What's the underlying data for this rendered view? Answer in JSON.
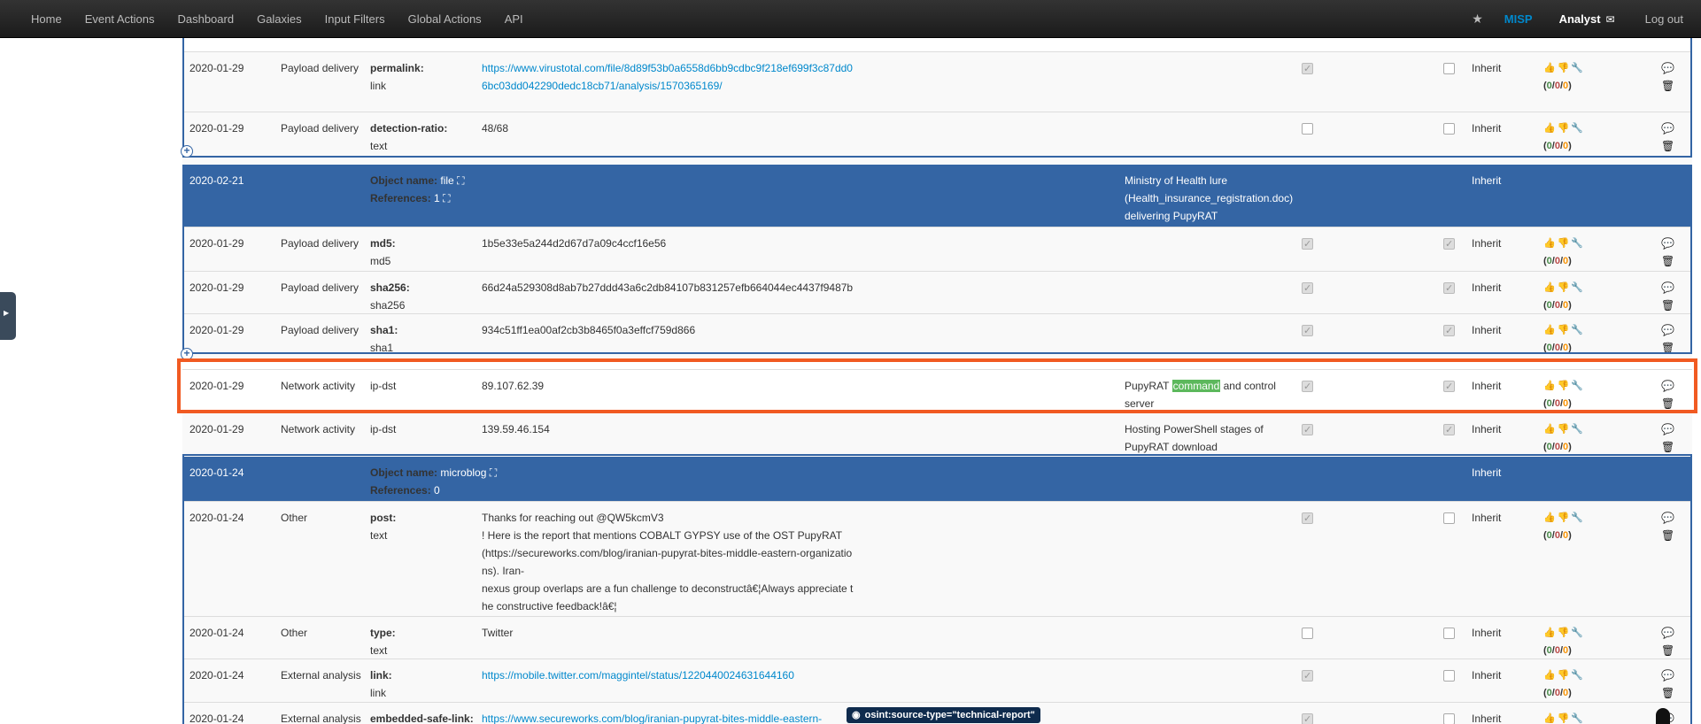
{
  "nav": {
    "items": [
      "Home",
      "Event Actions",
      "Dashboard",
      "Galaxies",
      "Input Filters",
      "Global Actions",
      "API"
    ],
    "star": "★",
    "misp": "MISP",
    "user": "Analyst",
    "logout": "Log out"
  },
  "rows": [
    {
      "date": "2020-01-29",
      "cat": "Payload delivery",
      "rel": "permalink:",
      "type": "link",
      "value": "https://www.virustotal.com/file/8d89f53b0a6558d6bb9cdbc9f218ef699f3c87dd06bc03dd042290dedc18cb71/analysis/1570365169/",
      "link": true,
      "comment": "",
      "ids": true,
      "corr": false,
      "dist": "Inherit"
    },
    {
      "date": "2020-01-29",
      "cat": "Payload delivery",
      "rel": "detection-ratio:",
      "type": "text",
      "value": "48/68",
      "comment": "",
      "ids": false,
      "corr": false,
      "dist": "Inherit"
    },
    {
      "obj": true,
      "date": "2020-02-21",
      "name_label": "Object name:",
      "name": "file",
      "refs_label": "References:",
      "refs": "1",
      "comment": "Ministry of Health lure (Health_insurance_registration.doc) delivering PupyRAT",
      "dist": "Inherit"
    },
    {
      "date": "2020-01-29",
      "cat": "Payload delivery",
      "rel": "md5:",
      "type": "md5",
      "value": "1b5e33e5a244d2d67d7a09c4ccf16e56",
      "comment": "",
      "ids": true,
      "corr": true,
      "dist": "Inherit"
    },
    {
      "date": "2020-01-29",
      "cat": "Payload delivery",
      "rel": "sha256:",
      "type": "sha256",
      "value": "66d24a529308d8ab7b27ddd43a6c2db84107b831257efb664044ec4437f9487b",
      "comment": "",
      "ids": true,
      "corr": true,
      "dist": "Inherit"
    },
    {
      "date": "2020-01-29",
      "cat": "Payload delivery",
      "rel": "sha1:",
      "type": "sha1",
      "value": "934c51ff1ea00af2cb3b8465f0a3effcf759d866",
      "comment": "",
      "ids": true,
      "corr": true,
      "dist": "Inherit"
    },
    {
      "date": "2020-01-29",
      "cat": "Network activity",
      "type_plain": "ip-dst",
      "value": "89.107.62.39",
      "comment_pre": "PupyRAT ",
      "comment_hl": "command",
      "comment_post": " and control server",
      "ids": true,
      "corr": true,
      "dist": "Inherit"
    },
    {
      "date": "2020-01-29",
      "cat": "Network activity",
      "type_plain": "ip-dst",
      "value": "139.59.46.154",
      "comment": "Hosting PowerShell stages of PupyRAT download",
      "ids": true,
      "corr": true,
      "dist": "Inherit"
    },
    {
      "obj": true,
      "date": "2020-01-24",
      "name_label": "Object name:",
      "name": "microblog",
      "refs_label": "References:",
      "refs": "0",
      "comment": "",
      "dist": "Inherit"
    },
    {
      "date": "2020-01-24",
      "cat": "Other",
      "rel": "post:",
      "type": "text",
      "value": "Thanks for reaching out @QW5kcmV3\n! Here is the report that mentions COBALT GYPSY use of the OST PupyRAT (https://secureworks.com/blog/iranian-pupyrat-bites-middle-eastern-organizations). Iran-\nnexus group overlaps are a fun challenge to deconstructâ€¦Always appreciate the constructive feedback!â€¦",
      "comment": "",
      "ids": true,
      "corr": false,
      "dist": "Inherit"
    },
    {
      "date": "2020-01-24",
      "cat": "Other",
      "rel": "type:",
      "type": "text",
      "value": "Twitter",
      "comment": "",
      "ids": false,
      "corr": false,
      "dist": "Inherit"
    },
    {
      "date": "2020-01-24",
      "cat": "External analysis",
      "rel": "link:",
      "type": "link",
      "value": "https://mobile.twitter.com/maggintel/status/1220440024631644160",
      "link": true,
      "comment": "",
      "ids": true,
      "corr": false,
      "dist": "Inherit"
    },
    {
      "date": "2020-01-24",
      "cat": "External analysis",
      "rel": "embedded-safe-link:",
      "type": "",
      "value": "https://www.secureworks.com/blog/iranian-pupyrat-bites-middle-eastern-",
      "link": true,
      "comment": "",
      "ids": true,
      "corr": false,
      "dist": "Inherit"
    }
  ],
  "sightings": {
    "icons": "👍👎🔧",
    "zero": "0",
    "sep": "/"
  },
  "actions": {
    "icons": "💬🗑"
  },
  "tag": {
    "label": "osint:source-type=\"technical-report\""
  },
  "colors": {
    "object_row": "#3465a4",
    "highlight_border": "#f15a22",
    "nav_bg": "#222222",
    "link": "#0088cc"
  }
}
